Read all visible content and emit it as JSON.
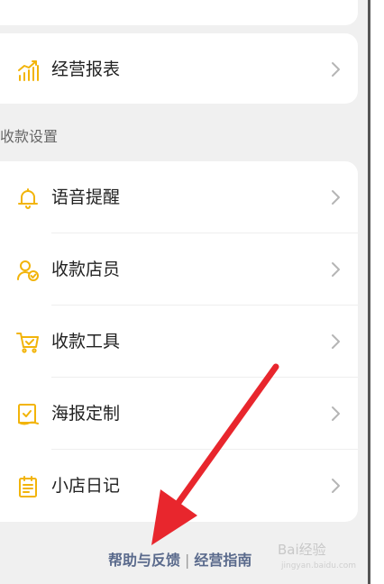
{
  "report_row": {
    "label": "经营报表",
    "icon": "chart-growth-icon"
  },
  "section_title": "收款设置",
  "settings_rows": [
    {
      "label": "语音提醒",
      "icon": "bell-icon"
    },
    {
      "label": "收款店员",
      "icon": "clerk-icon"
    },
    {
      "label": "收款工具",
      "icon": "cart-icon"
    },
    {
      "label": "海报定制",
      "icon": "poster-icon"
    },
    {
      "label": "小店日记",
      "icon": "notepad-icon"
    }
  ],
  "footer": {
    "help_link": "帮助与反馈",
    "separator": "|",
    "guide_link": "经营指南"
  },
  "watermark": {
    "text": "Bai经验",
    "sub": "jingyan.baidu.com"
  },
  "colors": {
    "icon_accent": "#f2b40a",
    "arrow": "#e8262d",
    "link": "#5a6a8c"
  }
}
